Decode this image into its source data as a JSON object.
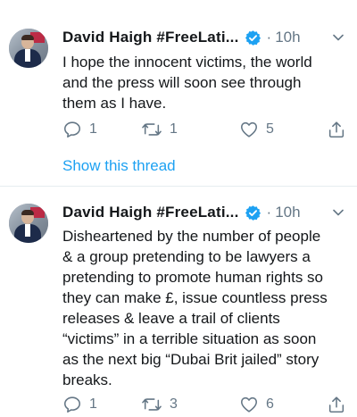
{
  "tweets": [
    {
      "author": "David Haigh #FreeLati...",
      "separator": "·",
      "time": "10h",
      "text": "I hope the innocent victims, the world\nand the press will soon see through\nthem as I have.",
      "replies": "1",
      "retweets": "1",
      "likes": "5",
      "show_thread": "Show this thread"
    },
    {
      "author": "David Haigh #FreeLati...",
      "separator": "·",
      "time": "10h",
      "text": "Disheartened by the number of people\n& a group pretending to be lawyers a\npretending to promote human rights so\nthey can make £, issue countless press\nreleases & leave a trail of clients\n“victims” in a terrible situation as soon\nas the next big “Dubai Brit jailed” story\nbreaks.",
      "replies": "1",
      "retweets": "3",
      "likes": "6"
    }
  ],
  "icons": {
    "verified": "verified-badge-icon",
    "caret": "chevron-down-icon",
    "reply": "reply-icon",
    "retweet": "retweet-icon",
    "like": "heart-icon",
    "share": "share-icon"
  },
  "colors": {
    "text": "#14171a",
    "secondary": "#657786",
    "accent": "#1da1f2",
    "divider": "#e6ecf0"
  }
}
